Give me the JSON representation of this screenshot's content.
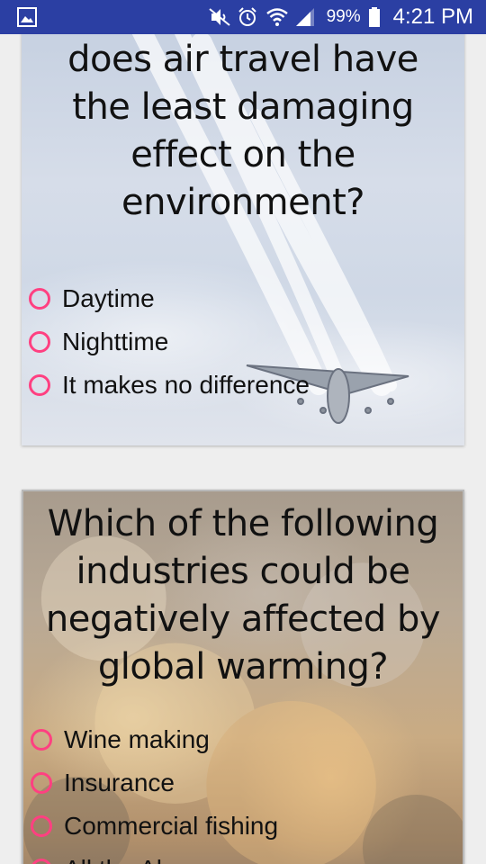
{
  "status_bar": {
    "battery": "99%",
    "time": "4:21 PM",
    "icons": [
      "gallery-icon",
      "mute-icon",
      "alarm-icon",
      "wifi-icon",
      "signal-icon",
      "battery-icon"
    ]
  },
  "colors": {
    "status_bar": "#2b3fa3",
    "radio_accent": "#ff4081",
    "page_background": "#eeeeee"
  },
  "questions": [
    {
      "text": "does air travel have the least damaging effect on the environment?",
      "background": "airplane-contrails-image",
      "options": [
        "Daytime",
        "Nighttime",
        "It makes no difference"
      ]
    },
    {
      "text": "Which of the following industries could be negatively affected by global warming?",
      "background": "smoke-clouds-image",
      "options": [
        "Wine making",
        "Insurance",
        "Commercial fishing",
        "All the Above"
      ]
    }
  ]
}
